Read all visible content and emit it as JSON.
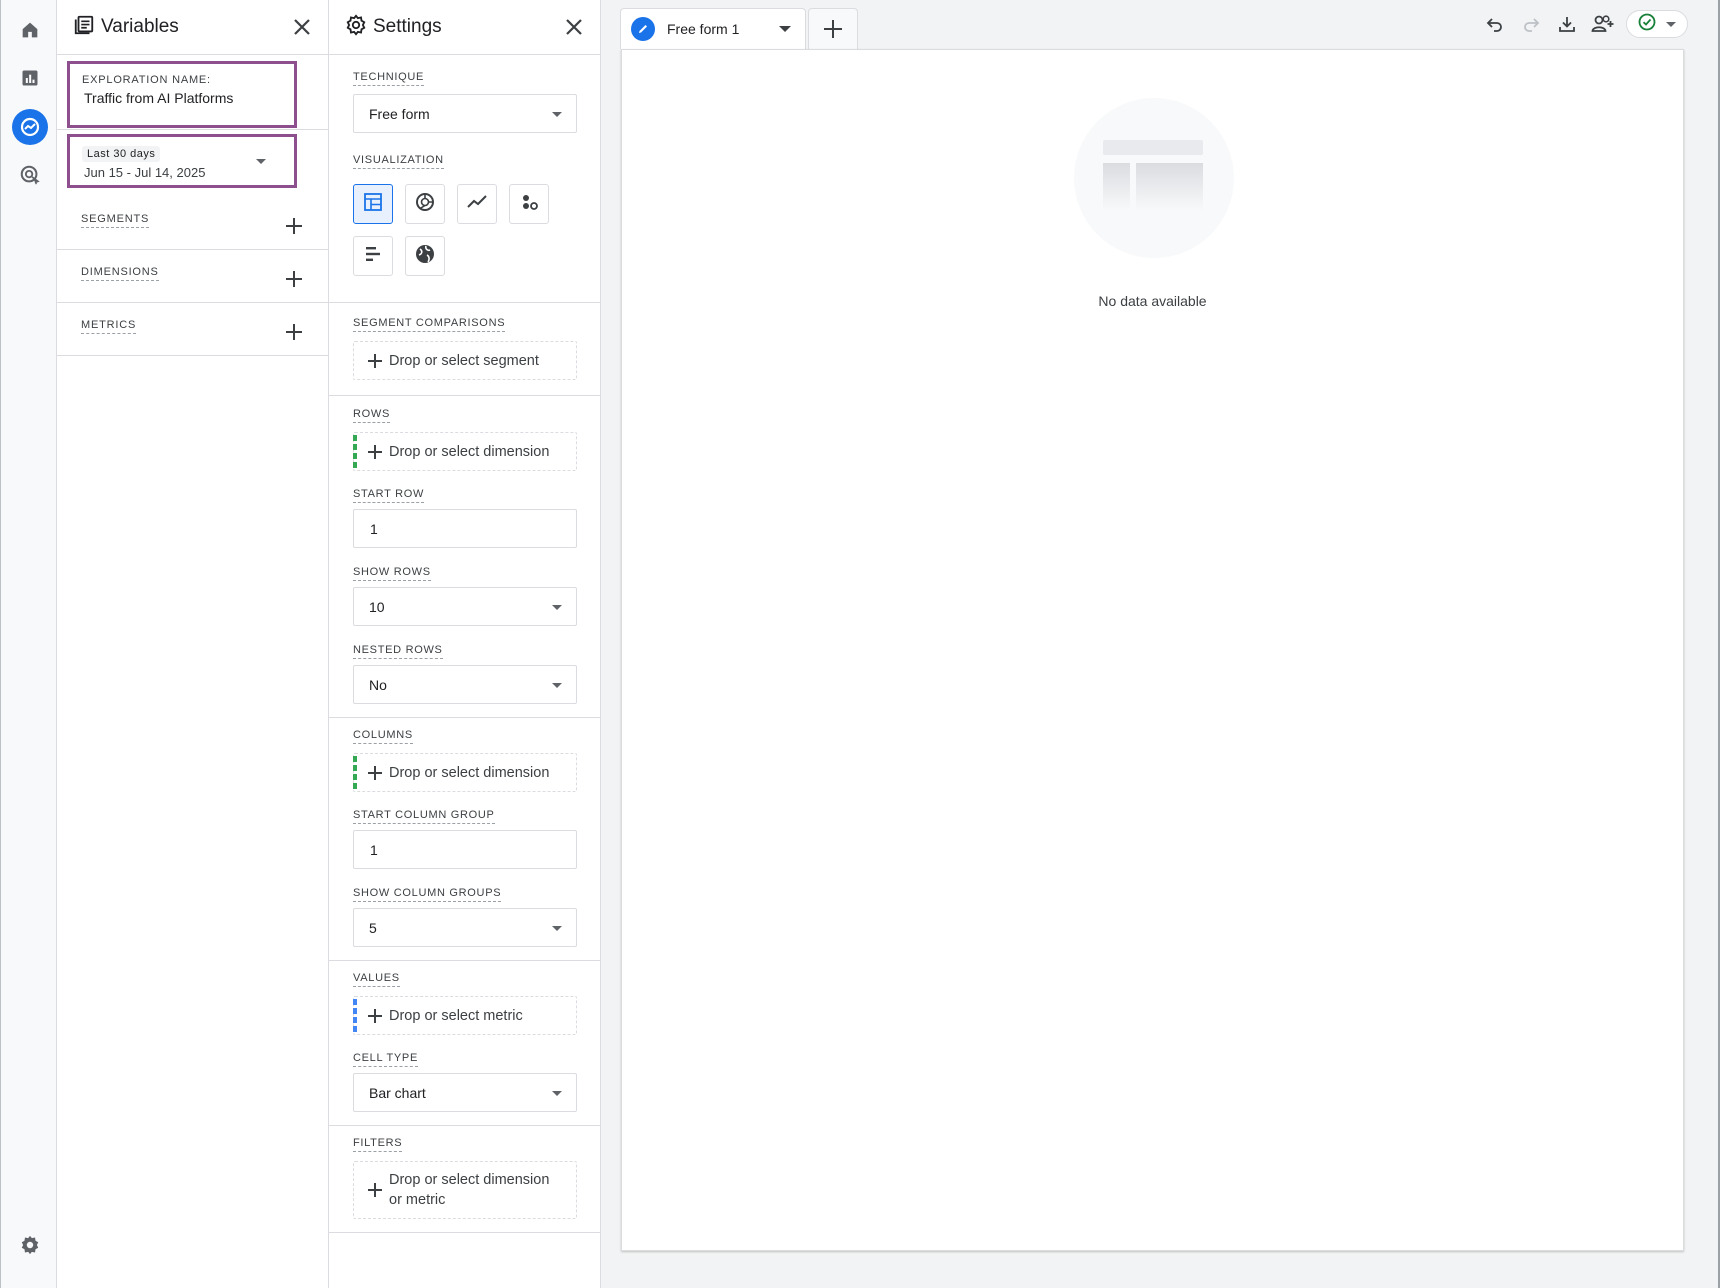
{
  "variables_panel": {
    "title": "Variables",
    "exploration_name_label": "EXPLORATION NAME:",
    "exploration_name": "Traffic from AI Platforms",
    "date_preset": "Last 30 days",
    "date_range": "Jun 15 - Jul 14, 2025",
    "sections": [
      "SEGMENTS",
      "DIMENSIONS",
      "METRICS"
    ]
  },
  "settings_panel": {
    "title": "Settings",
    "technique_label": "TECHNIQUE",
    "technique_value": "Free form",
    "visualization_label": "VISUALIZATION",
    "visualizations": [
      "table-icon",
      "donut-chart-icon",
      "line-chart-icon",
      "scatter-plot-icon",
      "bar-chart-icon",
      "globe-icon"
    ],
    "segment_comparisons_label": "SEGMENT COMPARISONS",
    "segment_drop": "Drop or select segment",
    "rows_label": "ROWS",
    "rows_drop": "Drop or select dimension",
    "start_row_label": "START ROW",
    "start_row": "1",
    "show_rows_label": "SHOW ROWS",
    "show_rows": "10",
    "nested_rows_label": "NESTED ROWS",
    "nested_rows": "No",
    "columns_label": "COLUMNS",
    "columns_drop": "Drop or select dimension",
    "start_column_group_label": "START COLUMN GROUP",
    "start_column_group": "1",
    "show_column_groups_label": "SHOW COLUMN GROUPS",
    "show_column_groups": "5",
    "values_label": "VALUES",
    "values_drop": "Drop or select metric",
    "cell_type_label": "CELL TYPE",
    "cell_type": "Bar chart",
    "filters_label": "FILTERS",
    "filters_drop_line1": "Drop or select dimension",
    "filters_drop_line2": "or metric"
  },
  "canvas": {
    "tab_title": "Free form 1",
    "empty_message": "No data available"
  },
  "colors": {
    "accent": "#1a73e8",
    "highlight_border": "#8e4f8e",
    "status_ok": "#188038"
  }
}
